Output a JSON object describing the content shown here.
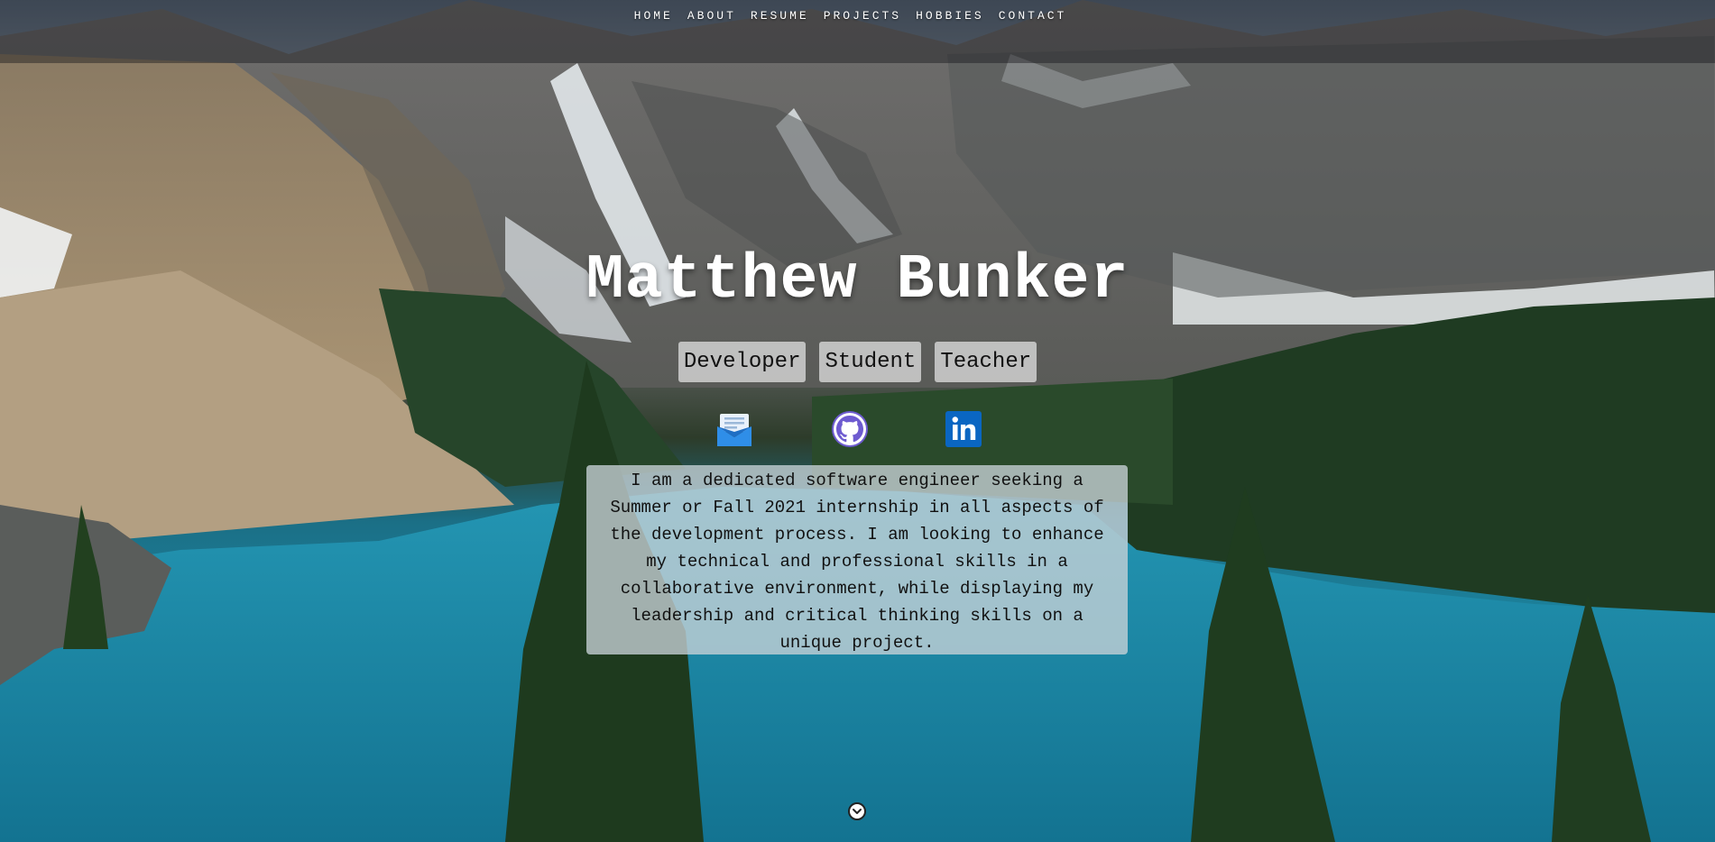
{
  "nav": {
    "items": [
      {
        "label": "HOME"
      },
      {
        "label": "ABOUT"
      },
      {
        "label": "RESUME"
      },
      {
        "label": "PROJECTS"
      },
      {
        "label": "HOBBIES"
      },
      {
        "label": "CONTACT"
      }
    ]
  },
  "hero": {
    "name": "Matthew Bunker",
    "roles": [
      "Developer",
      "Student",
      "Teacher"
    ],
    "about": "I am a dedicated software engineer seeking a Summer or Fall 2021 internship in all aspects of the development process. I am looking to enhance my technical and professional skills in a collaborative environment, while displaying my leadership and critical thinking skills on a unique project."
  },
  "socials": {
    "email": {
      "icon": "email-icon"
    },
    "github": {
      "icon": "github-icon"
    },
    "linkedin": {
      "icon": "linkedin-icon",
      "text": "in"
    }
  },
  "scroll": {
    "icon": "chevron-down-icon"
  },
  "colors": {
    "nav_bg": "#141418",
    "role_bg": "#e6e6e6",
    "about_bg": "#c8d2d7",
    "linkedin_blue": "#0a66c2",
    "github_purple": "#6e5bd0",
    "email_blue": "#2f8ee8"
  }
}
